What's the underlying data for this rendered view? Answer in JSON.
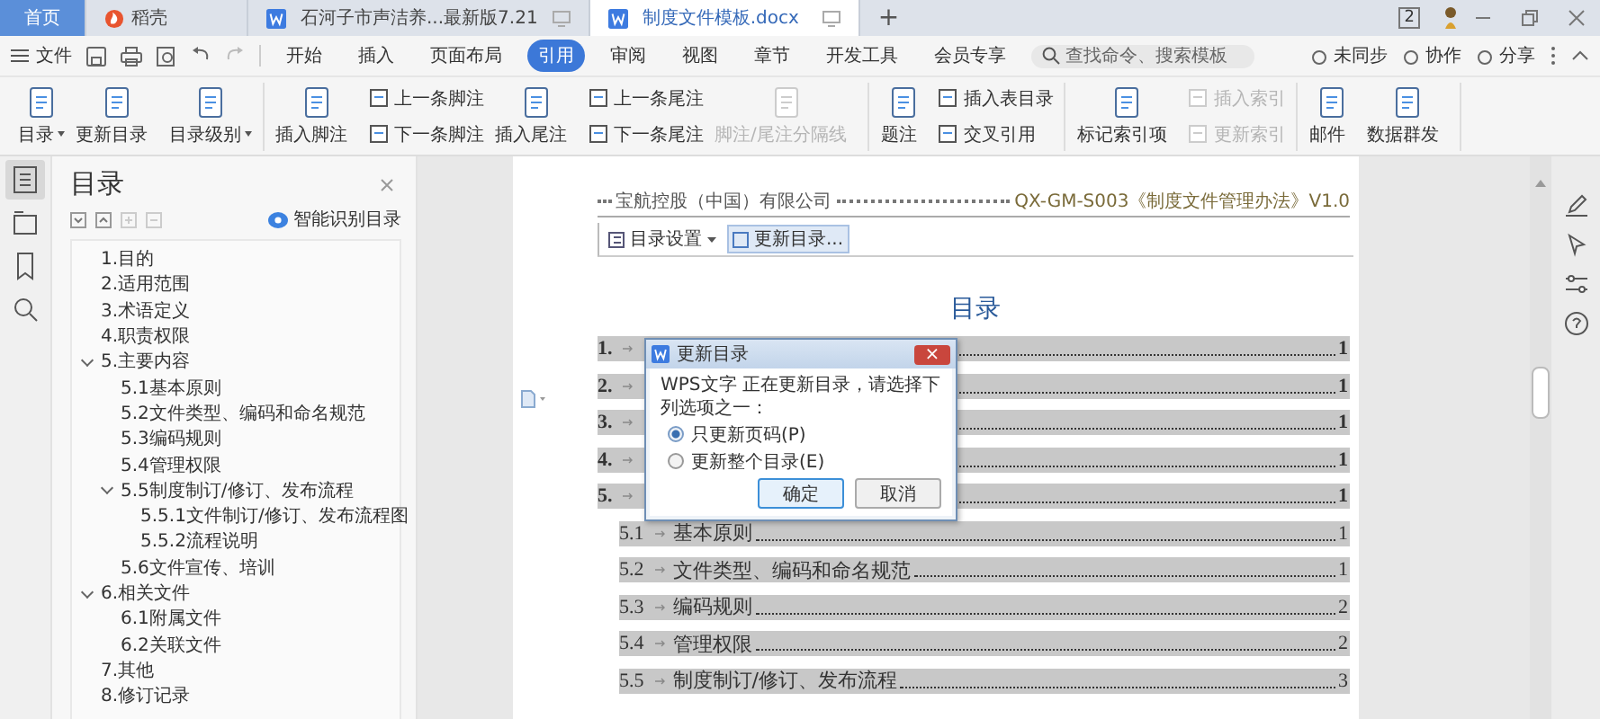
{
  "tabs": [
    {
      "label": "首页",
      "selected": false,
      "kind": "home"
    },
    {
      "label": "稻壳",
      "selected": false,
      "kind": "docer"
    },
    {
      "label": "石河子市声洁养...最新版7.21",
      "selected": false,
      "kind": "doc"
    },
    {
      "label": "制度文件模板.docx",
      "selected": true,
      "kind": "doc"
    }
  ],
  "new_tab": "+",
  "window_badge": "2",
  "menu": {
    "file": "文件",
    "items": [
      {
        "label": "开始",
        "selected": false
      },
      {
        "label": "插入",
        "selected": false
      },
      {
        "label": "页面布局",
        "selected": false
      },
      {
        "label": "引用",
        "selected": true
      },
      {
        "label": "审阅",
        "selected": false
      },
      {
        "label": "视图",
        "selected": false
      },
      {
        "label": "章节",
        "selected": false
      },
      {
        "label": "开发工具",
        "selected": false
      },
      {
        "label": "会员专享",
        "selected": false
      }
    ],
    "search": {
      "placeholder": "查找命令、搜索模板"
    },
    "actions": [
      "未同步",
      "协作",
      "分享"
    ]
  },
  "ribbon": [
    [
      {
        "kind": "large",
        "label": "目录",
        "dropdown": true,
        "disabled": false
      },
      {
        "kind": "large",
        "label": "更新目录",
        "dropdown": false,
        "disabled": false
      },
      {
        "kind": "large",
        "label": "目录级别",
        "dropdown": true,
        "disabled": false
      }
    ],
    [
      {
        "kind": "large",
        "label": "插入脚注",
        "dropdown": false,
        "disabled": false
      },
      {
        "kind": "pair",
        "labels": [
          "上一条脚注",
          "下一条脚注"
        ],
        "disabled": false
      },
      {
        "kind": "large",
        "label": "插入尾注",
        "dropdown": false,
        "disabled": false
      },
      {
        "kind": "pair",
        "labels": [
          "上一条尾注",
          "下一条尾注"
        ],
        "disabled": false
      },
      {
        "kind": "large",
        "label": "脚注/尾注分隔线",
        "dropdown": false,
        "disabled": true
      }
    ],
    [
      {
        "kind": "large",
        "label": "题注",
        "dropdown": false,
        "disabled": false
      },
      {
        "kind": "pair",
        "labels": [
          "插入表目录",
          "交叉引用"
        ],
        "disabled": false
      }
    ],
    [
      {
        "kind": "large",
        "label": "标记索引项",
        "dropdown": false,
        "disabled": false
      },
      {
        "kind": "pair",
        "labels": [
          "插入索引",
          "更新索引"
        ],
        "disabled": true
      }
    ],
    [
      {
        "kind": "large",
        "label": "邮件",
        "dropdown": false,
        "disabled": false
      },
      {
        "kind": "large",
        "label": "数据群发",
        "dropdown": false,
        "disabled": false
      }
    ]
  ],
  "nav": {
    "title": "目录",
    "smart_label": "智能识别目录",
    "items": [
      {
        "label": "1.目的"
      },
      {
        "label": "2.适用范围"
      },
      {
        "label": "3.术语定义"
      },
      {
        "label": "4.职责权限"
      },
      {
        "label": "5.主要内容",
        "expanded": true,
        "children": [
          {
            "label": "5.1基本原则"
          },
          {
            "label": "5.2文件类型、编码和命名规范"
          },
          {
            "label": "5.3编码规则"
          },
          {
            "label": "5.4管理权限"
          },
          {
            "label": "5.5制度制订/修订、发布流程",
            "expanded": true,
            "children": [
              {
                "label": "5.5.1文件制订/修订、发布流程图"
              },
              {
                "label": "5.5.2流程说明"
              }
            ]
          },
          {
            "label": "5.6文件宣传、培训"
          }
        ]
      },
      {
        "label": "6.相关文件",
        "expanded": true,
        "children": [
          {
            "label": "6.1附属文件"
          },
          {
            "label": "6.2关联文件"
          }
        ]
      },
      {
        "label": "7.其他"
      },
      {
        "label": "8.修订记录"
      }
    ]
  },
  "doc": {
    "header_left": "宝航控股（中国）有限公司",
    "header_right": "QX-GM-S003《制度文件管理办法》V1.0",
    "toc_tools": [
      "目录设置",
      "更新目录..."
    ],
    "title": "目录",
    "entries": [
      {
        "number": "1.",
        "page": "1"
      },
      {
        "number": "2.",
        "page": "1"
      },
      {
        "number": "3.",
        "page": "1"
      },
      {
        "number": "4.",
        "page": "1"
      },
      {
        "number": "5.",
        "page": "1",
        "children": [
          {
            "number": "5.1",
            "title": "基本原则",
            "page": "1"
          },
          {
            "number": "5.2",
            "title": "文件类型、编码和命名规范",
            "page": "1"
          },
          {
            "number": "5.3",
            "title": "编码规则",
            "page": "2"
          },
          {
            "number": "5.4",
            "title": "管理权限",
            "page": "2"
          },
          {
            "number": "5.5",
            "title": "制度制订/修订、发布流程",
            "page": "3"
          }
        ]
      }
    ]
  },
  "dialog": {
    "title": "更新目录",
    "close": "×",
    "message": "WPS文字 正在更新目录，请选择下列选项之一：",
    "options": [
      {
        "label": "只更新页码(P)",
        "selected": true
      },
      {
        "label": "更新整个目录(E)",
        "selected": false
      }
    ],
    "buttons": [
      {
        "label": "确定",
        "kind": "primary"
      },
      {
        "label": "取消",
        "kind": "normal"
      }
    ]
  }
}
